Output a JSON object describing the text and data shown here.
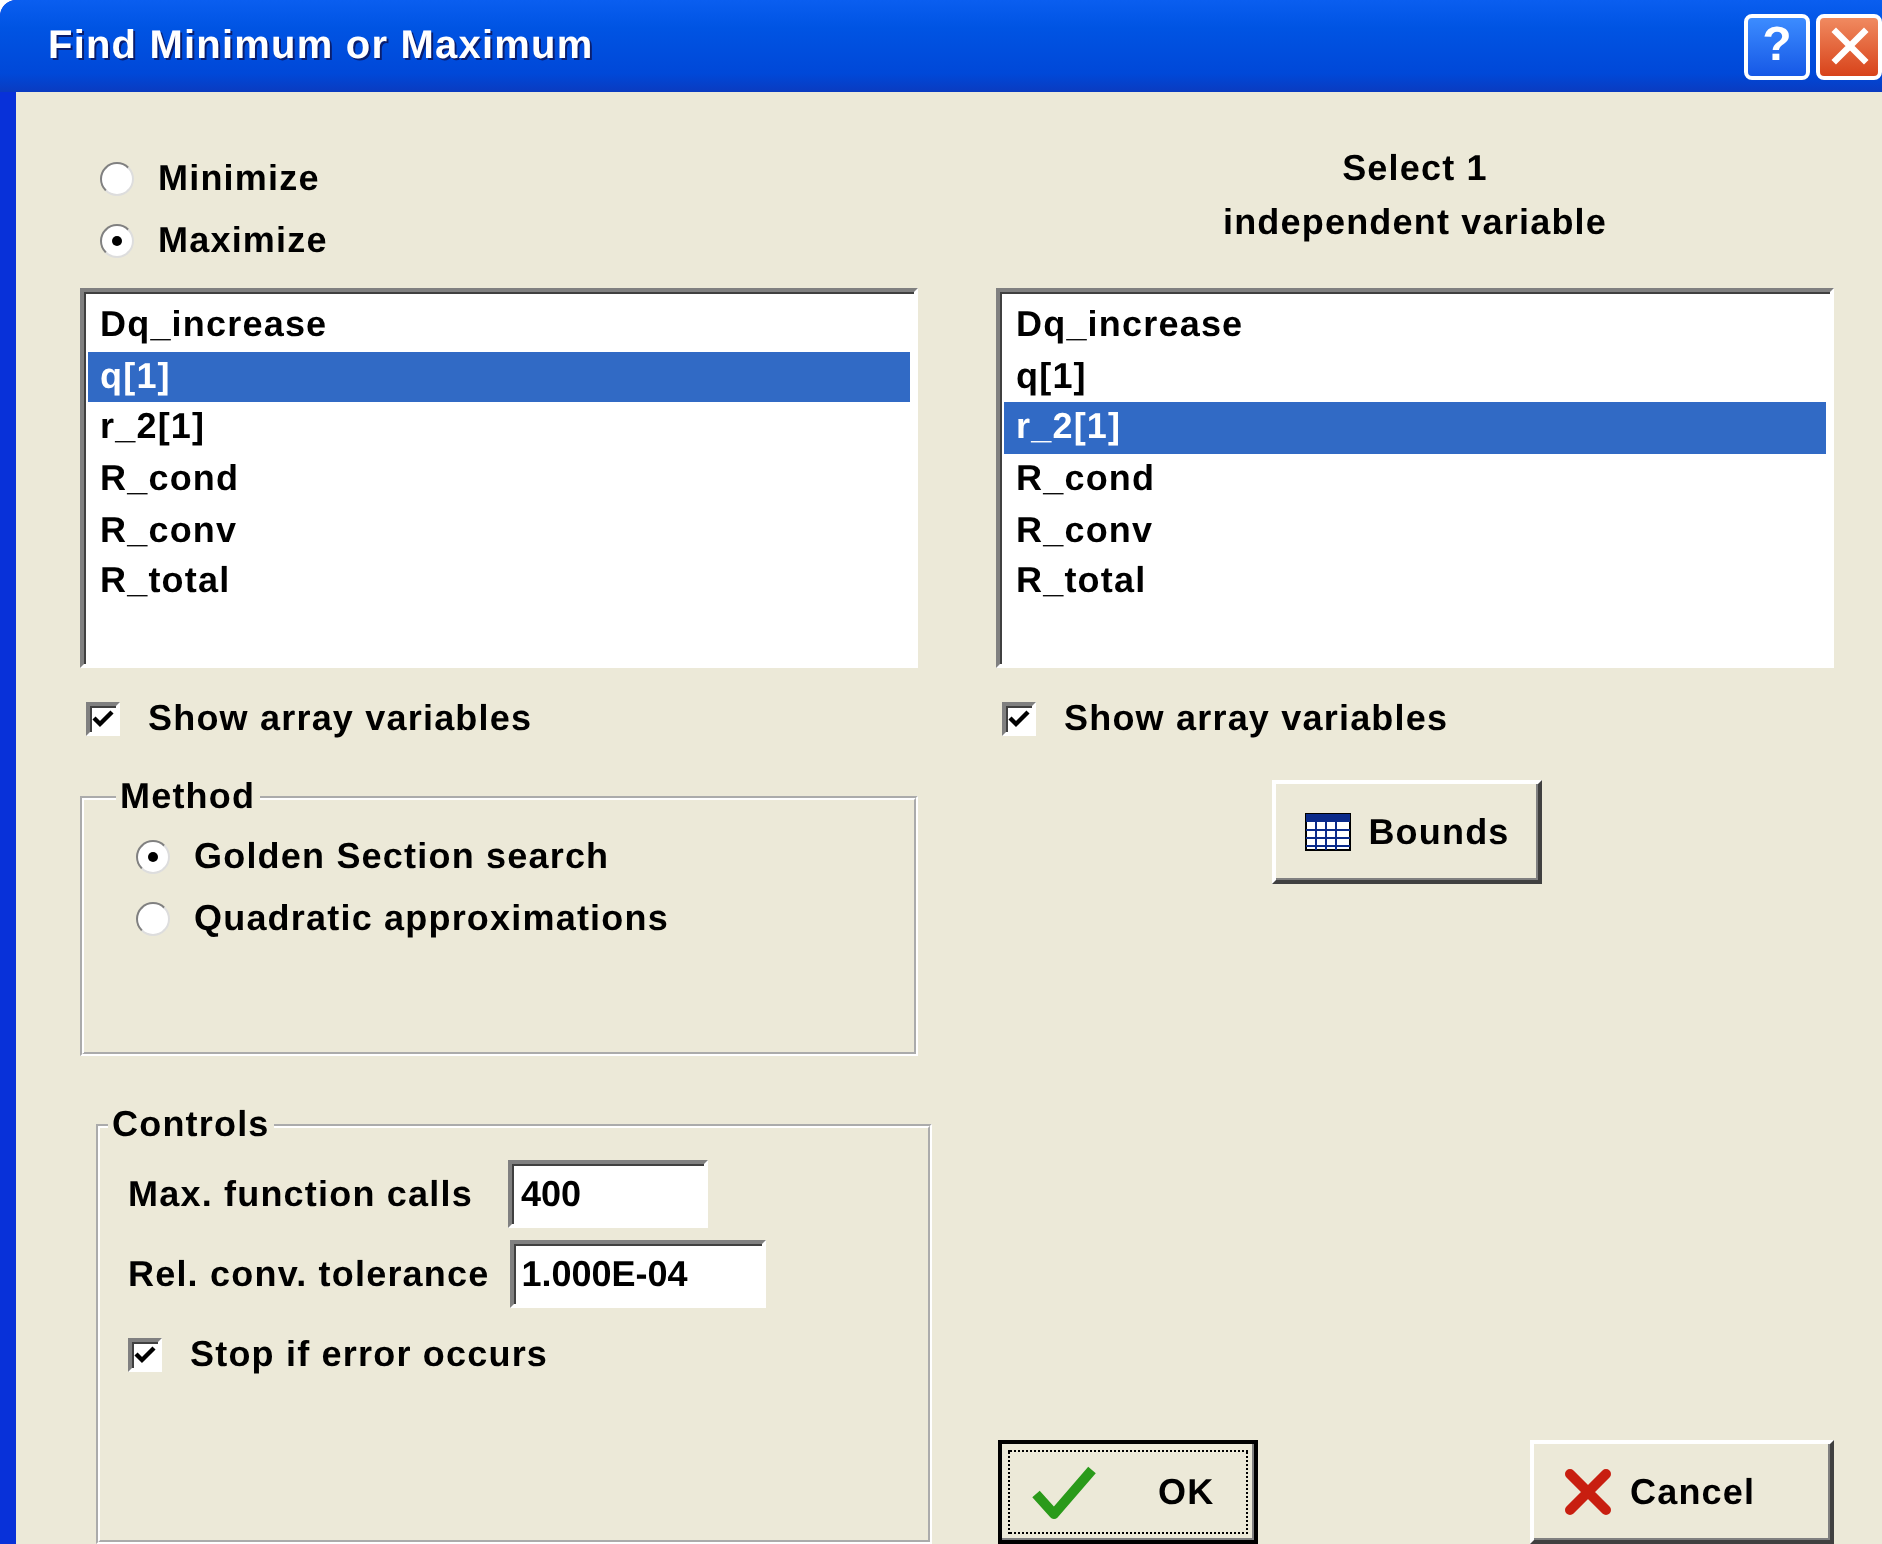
{
  "window": {
    "title": "Find Minimum or Maximum",
    "help_button": "?"
  },
  "objective": [
    {
      "label": "Minimize",
      "selected": false
    },
    {
      "label": "Maximize",
      "selected": true
    }
  ],
  "right_heading": [
    "Select 1",
    "independent variable"
  ],
  "lists": [
    {
      "items": [
        {
          "label": "Dq_increase",
          "selected": false
        },
        {
          "label": "q[1]",
          "selected": true
        },
        {
          "label": "r_2[1]",
          "selected": false
        },
        {
          "label": "R_cond",
          "selected": false
        },
        {
          "label": "R_conv",
          "selected": false
        },
        {
          "label": "R_total",
          "selected": false
        }
      ],
      "show_array": {
        "label": "Show array variables",
        "checked": true
      }
    },
    {
      "items": [
        {
          "label": "Dq_increase",
          "selected": false
        },
        {
          "label": "q[1]",
          "selected": false
        },
        {
          "label": "r_2[1]",
          "selected": true
        },
        {
          "label": "R_cond",
          "selected": false
        },
        {
          "label": "R_conv",
          "selected": false
        },
        {
          "label": "R_total",
          "selected": false
        }
      ],
      "show_array": {
        "label": "Show array variables",
        "checked": true
      }
    }
  ],
  "method": {
    "title": "Method",
    "options": [
      {
        "label": "Golden Section search",
        "selected": true
      },
      {
        "label": "Quadratic approximations",
        "selected": false
      }
    ]
  },
  "bounds_button": "Bounds",
  "controls": {
    "title": "Controls",
    "fields": [
      {
        "label": "Max. function calls",
        "value": "400"
      },
      {
        "label": "Rel. conv. tolerance",
        "value": "1.000E-04"
      }
    ],
    "stop_on_error": {
      "label": "Stop if error occurs",
      "checked": true
    }
  },
  "buttons": [
    {
      "kind": "ok",
      "label": "OK"
    },
    {
      "kind": "cancel",
      "label": "Cancel"
    }
  ]
}
